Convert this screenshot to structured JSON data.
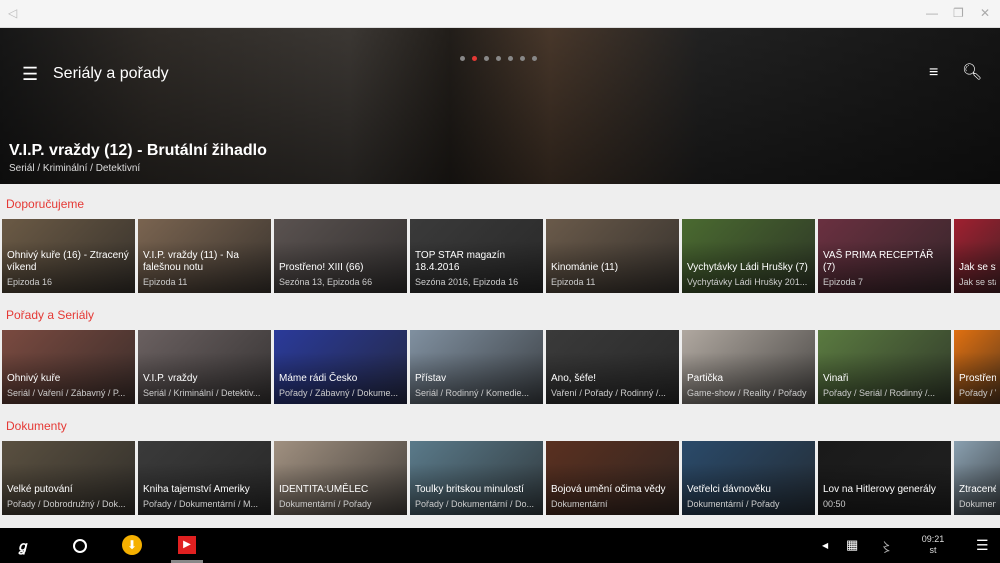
{
  "header": {
    "title": "Seriály a pořady",
    "featured_title": "V.I.P. vraždy (12) - Brutální žihadlo",
    "featured_subtitle": "Seriál / Kriminální / Detektivní",
    "carousel_pages": 7,
    "carousel_active": 1
  },
  "colors": {
    "accent": "#e53935"
  },
  "sections": [
    {
      "label": "Doporučujeme",
      "cards": [
        {
          "title": "Ohnivý kuře (16) - Ztracený víkend",
          "subtitle": "Epizoda 16",
          "bg": "#6b5a45"
        },
        {
          "title": "V.I.P. vraždy (11) - Na falešnou notu",
          "subtitle": "Epizoda 11",
          "bg": "#7a6450"
        },
        {
          "title": "Prostřeno! XIII (66)",
          "subtitle": "Sezóna 13, Epizoda 66",
          "bg": "#5a5250"
        },
        {
          "title": "TOP STAR magazín 18.4.2016",
          "subtitle": "Sezóna 2016, Epizoda 16",
          "bg": "#3a3a3a"
        },
        {
          "title": "Kinománie (11)",
          "subtitle": "Epizoda 11",
          "bg": "#6a5a4a"
        },
        {
          "title": "Vychytávky Ládi Hrušky (7)",
          "subtitle": "Vychytávky Ládi Hrušky 201...",
          "bg": "#4a6a30"
        },
        {
          "title": "VAŠ PRIMA RECEPTÁŘ (7)",
          "subtitle": "Epizoda 7",
          "bg": "#6a3040"
        },
        {
          "title": "Jak se sta...",
          "subtitle": "Jak se sta...",
          "bg": "#a02030"
        }
      ]
    },
    {
      "label": "Pořady a Seriály",
      "cards": [
        {
          "title": "Ohnivý kuře",
          "subtitle": "Seriál / Vaření / Zábavný / P...",
          "bg": "#7a4a40"
        },
        {
          "title": "V.I.P. vraždy",
          "subtitle": "Seriál / Kriminální / Detektiv...",
          "bg": "#6a6060"
        },
        {
          "title": "Máme rádi Česko",
          "subtitle": "Pořady / Zábavný / Dokume...",
          "bg": "#2a3a9a"
        },
        {
          "title": "Přístav",
          "subtitle": "Seriál / Rodinný / Komedie...",
          "bg": "#8090a0"
        },
        {
          "title": "Ano, šéfe!",
          "subtitle": "Vaření / Pořady / Rodinný /...",
          "bg": "#3a3a3a"
        },
        {
          "title": "Partička",
          "subtitle": "Game-show / Reality / Pořady",
          "bg": "#b0a8a0"
        },
        {
          "title": "Vinaři",
          "subtitle": "Pořady / Seriál / Rodinný /...",
          "bg": "#5a7a40"
        },
        {
          "title": "Prostřeno...",
          "subtitle": "Pořady / V...",
          "bg": "#e07010"
        }
      ]
    },
    {
      "label": "Dokumenty",
      "cards": [
        {
          "title": "Velké putování",
          "subtitle": "Pořady / Dobrodružný / Dok...",
          "bg": "#5a5040"
        },
        {
          "title": "Kniha tajemství Ameriky",
          "subtitle": "Pořady / Dokumentární / M...",
          "bg": "#3a3a3a"
        },
        {
          "title": "IDENTITA:UMĚLEC",
          "subtitle": "Dokumentární / Pořady",
          "bg": "#a09080"
        },
        {
          "title": "Toulky britskou minulostí",
          "subtitle": "Pořady / Dokumentární / Do...",
          "bg": "#5a7a8a"
        },
        {
          "title": "Bojová umění očima vědy",
          "subtitle": "Dokumentární",
          "bg": "#5a3020"
        },
        {
          "title": "Vetřelci dávnověku",
          "subtitle": "Dokumentární / Pořady",
          "bg": "#2a4a6a"
        },
        {
          "title": "Lov na Hitlerovy generály",
          "subtitle": "00:50",
          "bg": "#1a1a1a"
        },
        {
          "title": "Ztracené s...",
          "subtitle": "Dokument...",
          "bg": "#8aa0b0"
        }
      ]
    }
  ],
  "taskbar": {
    "time": "09:21",
    "day": "st"
  }
}
